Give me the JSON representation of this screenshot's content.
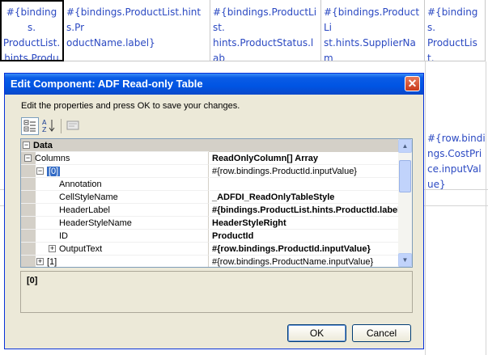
{
  "spreadsheet": {
    "header_cells": [
      "#{bindings.\nProductList.\nhints.Produ\nctId.label}",
      "#{bindings.ProductList.hints.Pr\noductName.label}",
      "#{bindings.ProductList.\nhints.ProductStatus.lab\nel}",
      "#{bindings.ProductLi\nst.hints.SupplierNam\ne.label}",
      "#{bindings.\nProductList.\nhints.CostP\nrice.label}"
    ],
    "side_cell": "#{row.bindi\nngs.CostPri\nce.inputVal\nue}"
  },
  "dialog": {
    "title": "Edit Component: ADF Read-only Table",
    "close_glyph": "✕",
    "instructions": "Edit the properties and press OK to save your changes.",
    "toolbar": {
      "categorized_icon": "categorized-icon",
      "sort_az_icon": "sort-az-icon",
      "property_pages_icon": "property-pages-icon"
    },
    "properties": [
      {
        "name": "Data",
        "value": "",
        "kind": "category",
        "expander": "−",
        "indent": 0
      },
      {
        "name": "Columns",
        "value": "ReadOnlyColumn[] Array",
        "expander": "−",
        "indent": 0,
        "value_bold": true
      },
      {
        "name": "[0]",
        "value": "#{row.bindings.ProductId.inputValue}",
        "expander": "−",
        "indent": 1,
        "selected": true
      },
      {
        "name": "Annotation",
        "value": "",
        "indent": 2
      },
      {
        "name": "CellStyleName",
        "value": "_ADFDI_ReadOnlyTableStyle",
        "indent": 2,
        "value_bold": true
      },
      {
        "name": "HeaderLabel",
        "value": "#{bindings.ProductList.hints.ProductId.label}",
        "indent": 2,
        "value_bold": true
      },
      {
        "name": "HeaderStyleName",
        "value": "HeaderStyleRight",
        "indent": 2,
        "value_bold": true
      },
      {
        "name": "ID",
        "value": "ProductId",
        "indent": 2,
        "value_bold": true
      },
      {
        "name": "OutputText",
        "value": "#{row.bindings.ProductId.inputValue}",
        "expander": "+",
        "indent": 2,
        "value_bold": true
      },
      {
        "name": "[1]",
        "value": "#{row.bindings.ProductName.inputValue}",
        "expander": "+",
        "indent": 1
      }
    ],
    "description": "[0]",
    "ok_label": "OK",
    "cancel_label": "Cancel",
    "scroll_up_glyph": "▲",
    "scroll_down_glyph": "▼"
  }
}
